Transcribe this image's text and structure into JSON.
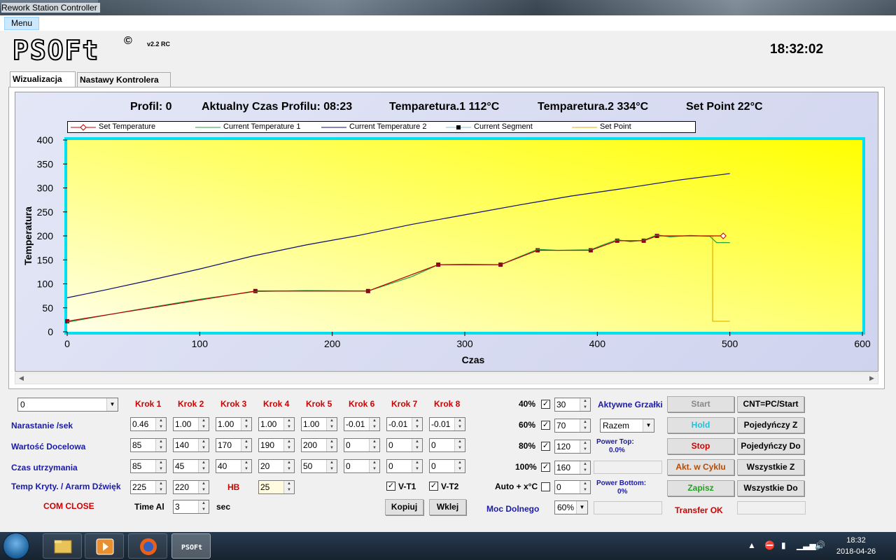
{
  "window": {
    "title": "Rework Station Controller"
  },
  "menu": {
    "label": "Menu"
  },
  "app": {
    "logo": "PSOFt",
    "copyright": "©",
    "version": "v2.2 RC",
    "clock": "18:32:02"
  },
  "tabs": [
    {
      "label": "Wizualizacja"
    },
    {
      "label": "Nastawy Kontrolera"
    }
  ],
  "status": {
    "profil": "Profil: 0",
    "czas": "Aktualny Czas Profilu: 08:23",
    "temp1": "Temparetura.1  112°C",
    "temp2": "Temparetura.2  334°C",
    "setpoint": "Set Point 22°C"
  },
  "chart_data": {
    "type": "line",
    "xlabel": "Czas",
    "ylabel": "Temperatura",
    "xlim": [
      0,
      600
    ],
    "ylim": [
      0,
      400
    ],
    "x_ticks": [
      0,
      100,
      200,
      300,
      400,
      500,
      600
    ],
    "y_ticks": [
      0,
      50,
      100,
      150,
      200,
      250,
      300,
      350,
      400
    ],
    "grid": false,
    "legend_position": "top",
    "series": [
      {
        "name": "Set Temperature",
        "color": "#c00000",
        "marker": "diamond",
        "x": [
          0,
          142,
          227,
          280,
          327,
          355,
          395,
          415,
          435,
          445,
          460,
          485,
          495
        ],
        "y": [
          22,
          85,
          85,
          140,
          140,
          170,
          170,
          190,
          190,
          200,
          200,
          200,
          200
        ]
      },
      {
        "name": "Current Temperature 1",
        "color": "#20a040",
        "x": [
          0,
          50,
          100,
          142,
          180,
          227,
          260,
          280,
          300,
          327,
          340,
          355,
          370,
          395,
          405,
          415,
          425,
          435,
          445,
          455,
          470,
          485,
          490,
          495,
          500
        ],
        "y": [
          20,
          45,
          68,
          84,
          86,
          85,
          115,
          140,
          141,
          140,
          155,
          172,
          170,
          171,
          182,
          192,
          188,
          191,
          202,
          198,
          201,
          199,
          186,
          186,
          186
        ]
      },
      {
        "name": "Current Temperature 2",
        "color": "#0a0a70",
        "x": [
          0,
          30,
          60,
          100,
          140,
          180,
          220,
          260,
          300,
          340,
          380,
          420,
          460,
          500
        ],
        "y": [
          71,
          88,
          106,
          131,
          158,
          181,
          201,
          224,
          244,
          264,
          283,
          299,
          316,
          330
        ]
      },
      {
        "name": "Current Segment",
        "color": "#80c0e0",
        "marker": "square",
        "x": [
          0,
          142,
          227,
          280,
          327,
          355,
          395,
          415,
          435,
          445
        ],
        "y": [
          22,
          85,
          85,
          140,
          140,
          170,
          170,
          190,
          190,
          200
        ]
      },
      {
        "name": "Set Point",
        "color": "#e0b000",
        "x": [
          485,
          487,
          487,
          490,
          500
        ],
        "y": [
          200,
          200,
          22,
          22,
          22
        ]
      }
    ]
  },
  "controls": {
    "profile_select": "0",
    "steps": [
      "Krok 1",
      "Krok 2",
      "Krok 3",
      "Krok 4",
      "Krok 5",
      "Krok 6",
      "Krok 7",
      "Krok 8"
    ],
    "rows": [
      {
        "label": "Narastanie /sek",
        "values": [
          "0.46",
          "1.00",
          "1.00",
          "1.00",
          "1.00",
          "-0.01",
          "-0.01",
          "-0.01"
        ]
      },
      {
        "label": "Wartość Docelowa",
        "values": [
          "85",
          "140",
          "170",
          "190",
          "200",
          "0",
          "0",
          "0"
        ]
      },
      {
        "label": "Czas utrzymania",
        "values": [
          "85",
          "45",
          "40",
          "20",
          "50",
          "0",
          "0",
          "0"
        ]
      }
    ],
    "temp_kryt_label": "Temp Kryty. / Ararm Dźwięk",
    "temp_kryt_values": [
      "225",
      "220"
    ],
    "hb_label": "HB",
    "hb_value": "25",
    "com_status": "COM CLOSE",
    "time_al_label": "Time Al",
    "time_al_value": "3",
    "sec_label": "sec",
    "vt1_label": "V-T1",
    "vt2_label": "V-T2",
    "kopiuj": "Kopiuj",
    "wklej": "Wklej",
    "pct_rows": [
      {
        "label": "40%",
        "checked": true,
        "value": "30"
      },
      {
        "label": "60%",
        "checked": true,
        "value": "70"
      },
      {
        "label": "80%",
        "checked": true,
        "value": "120"
      },
      {
        "label": "100%",
        "checked": true,
        "value": "160"
      }
    ],
    "auto_label": "Auto + x°C",
    "auto_value": "0",
    "moc_label": "Moc Dolnego",
    "moc_value": "60%",
    "aktywne_label": "Aktywne Grzałki",
    "aktywne_value": "Razem",
    "power_top_label": "Power Top:",
    "power_top_value": "0.0%",
    "power_bottom_label": "Power Bottom:",
    "power_bottom_value": "0%",
    "transfer_status": "Transfer OK",
    "buttons": {
      "start": "Start",
      "hold": "Hold",
      "stop": "Stop",
      "akt": "Akt. w Cyklu",
      "zapisz": "Zapisz",
      "cnt": "CNT=PC/Start",
      "poj_z": "Pojedyńczy Z",
      "poj_do": "Pojedyńczy Do",
      "wsz_z": "Wszystkie Z",
      "wsz_do": "Wszystkie Do"
    }
  },
  "taskbar": {
    "active_app": "PSOFt",
    "time": "18:32",
    "date": "2018-04-26"
  },
  "colors": {
    "chart_bg_start": "#ffff00",
    "chart_bg_end": "#ffffe8",
    "chart_border": "#00e0f0",
    "accent_blue": "#1a1aa8",
    "accent_red": "#d00000"
  }
}
